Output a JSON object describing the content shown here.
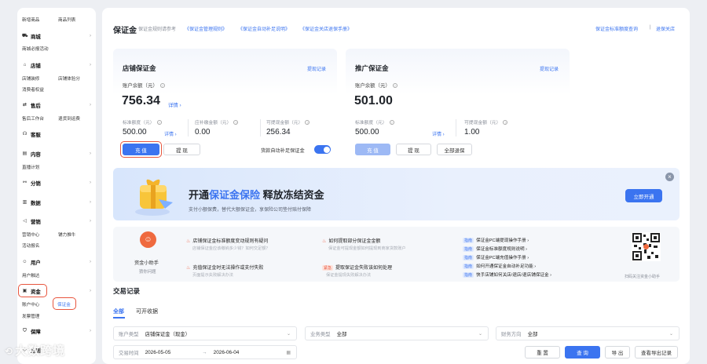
{
  "sidebar": {
    "top_links": [
      "新增商品",
      "商品列表"
    ],
    "mall": {
      "label": "商城",
      "links": [
        "商城必报活动"
      ]
    },
    "shop": {
      "label": "店铺",
      "links": [
        "店铺装修",
        "店铺体验分",
        "消费者权益"
      ]
    },
    "aftersale": {
      "label": "售后",
      "links": [
        "售后工作台",
        "退货到运费"
      ]
    },
    "service": {
      "label": "客服"
    },
    "content": {
      "label": "内容",
      "links": [
        "直播计划"
      ]
    },
    "distribution": {
      "label": "分销"
    },
    "data": {
      "label": "数据"
    },
    "marketing": {
      "label": "营销",
      "links": [
        "营销中心",
        "铺力推牛",
        "活动报名"
      ]
    },
    "user": {
      "label": "用户",
      "links": [
        "用户触达"
      ]
    },
    "funds": {
      "label": "资金",
      "links": [
        "账户中心",
        "保证金",
        "发票管理"
      ]
    },
    "guarantee": {
      "label": "保障"
    },
    "last": {
      "label": "定则"
    }
  },
  "header": {
    "title": "保证金",
    "rules_prefix": "保证金规则请参考",
    "rule_links": [
      "《保证金管理规则》",
      "《保证金自动补足说明》",
      "《保证金关店退保手册》"
    ],
    "right_link_1": "保证金标准额度查询",
    "divider": "|",
    "right_link_2": "退保关店"
  },
  "shop_deposit": {
    "title": "店铺保证金",
    "records_link": "提现记录",
    "balance_label": "账户余额（元）",
    "balance": "756.34",
    "detail_link": "详情 ›",
    "standard_label": "标准额度（元）",
    "standard_value": "500.00",
    "standard_detail": "详情 ›",
    "due_label": "应补缴金额（元）",
    "due_value": "0.00",
    "withdrawable_label": "可提现金额（元）",
    "withdrawable_value": "256.34",
    "recharge_btn": "充 值",
    "withdraw_btn": "提 现",
    "auto_topup_label": "货款自动补足保证金"
  },
  "promo_deposit": {
    "title": "推广保证金",
    "records_link": "提现记录",
    "balance_label": "账户余额（元）",
    "balance": "501.00",
    "standard_label": "标准额度（元）",
    "standard_value": "500.00",
    "standard_detail": "详情 ›",
    "withdrawable_label": "可提现金额（元）",
    "withdrawable_value": "1.00",
    "recharge_btn": "充 值",
    "withdraw_btn": "提 现",
    "refund_all_btn": "全部退保"
  },
  "banner": {
    "title_a": "开通",
    "title_b": "保证金保险",
    "title_c": " 释放冻结资金",
    "subtitle": "支付小额保费，替代大额保证金，享保险公司垫付赔付保障",
    "button": "立即开通",
    "close": "×"
  },
  "helper": {
    "name": "资金小助手",
    "sub": "猜你问题",
    "faq": [
      {
        "title": "店铺保证金标准额度变动规则有疑问",
        "sub": "店铺保证金应该缴纳多少钱？如何交足额？",
        "tag": "fire"
      },
      {
        "title": "如何提取部分保证金金额",
        "sub": "保证金可提现金额如何提现到商家货款账户",
        "tag": "fire"
      },
      {
        "title": "充值保证金时无法操作或支付失败",
        "sub": "页面提示失败解决办法",
        "tag": "fire"
      },
      {
        "title": "提取保证金失败该如何处理",
        "sub": "保证金提现失败解决办法",
        "tag": "紧急"
      }
    ],
    "guides": [
      {
        "tag": "指南",
        "text": "保证金PC端提现操作手册 ›"
      },
      {
        "tag": "指南",
        "text": "保证金标准额度规则说明 ›"
      },
      {
        "tag": "指南",
        "text": "保证金PC端充值操作手册 ›"
      },
      {
        "tag": "指南",
        "text": "如何开通保证金自动补足功能 ›"
      },
      {
        "tag": "指南",
        "text": "快手店铺如何关店/退店/退店铺保证金 ›"
      }
    ],
    "qr_caption": "扫码关注资金小助手"
  },
  "transactions": {
    "title": "交易记录",
    "tabs": [
      "全部",
      "可开收据"
    ],
    "filters": {
      "account_label": "账户类型",
      "account_value": "店铺保证金（现金）",
      "biz_label": "业务类型",
      "biz_value": "全部",
      "direction_label": "财务方向",
      "direction_value": "全部",
      "time_label": "交易时间",
      "date_from": "2026-05-05",
      "date_sep": "→",
      "date_to": "2026-06-04"
    },
    "buttons": {
      "reset": "重 置",
      "search": "查 询",
      "export": "导 出",
      "export_records": "查看导出记录"
    }
  },
  "watermark": "大数跨境",
  "colors": {
    "accent": "#3b74f0",
    "highlight": "#e8553e",
    "background": "#edeff3"
  }
}
